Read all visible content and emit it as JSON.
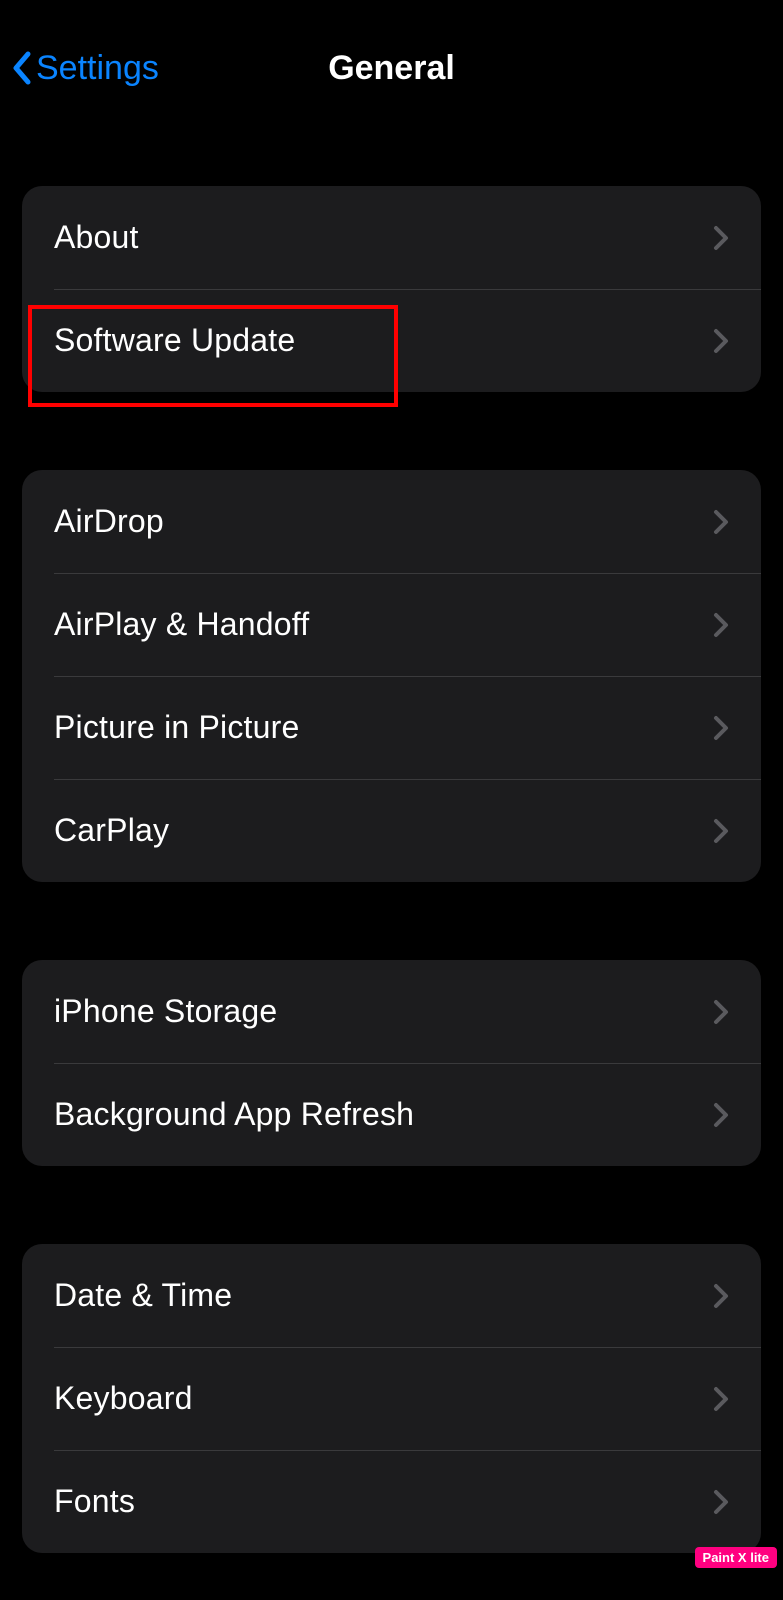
{
  "nav": {
    "back_label": "Settings",
    "title": "General"
  },
  "groups": [
    {
      "rows": [
        {
          "name": "about",
          "label": "About"
        },
        {
          "name": "software-update",
          "label": "Software Update"
        }
      ]
    },
    {
      "rows": [
        {
          "name": "airdrop",
          "label": "AirDrop"
        },
        {
          "name": "airplay-handoff",
          "label": "AirPlay & Handoff"
        },
        {
          "name": "picture-in-picture",
          "label": "Picture in Picture"
        },
        {
          "name": "carplay",
          "label": "CarPlay"
        }
      ]
    },
    {
      "rows": [
        {
          "name": "iphone-storage",
          "label": "iPhone Storage"
        },
        {
          "name": "background-app-refresh",
          "label": "Background App Refresh"
        }
      ]
    },
    {
      "rows": [
        {
          "name": "date-time",
          "label": "Date & Time"
        },
        {
          "name": "keyboard",
          "label": "Keyboard"
        },
        {
          "name": "fonts",
          "label": "Fonts"
        }
      ]
    }
  ],
  "highlight": {
    "target": "software-update"
  },
  "watermark": "Paint X lite",
  "colors": {
    "accent": "#0a84ff",
    "highlight": "#ff0000"
  }
}
